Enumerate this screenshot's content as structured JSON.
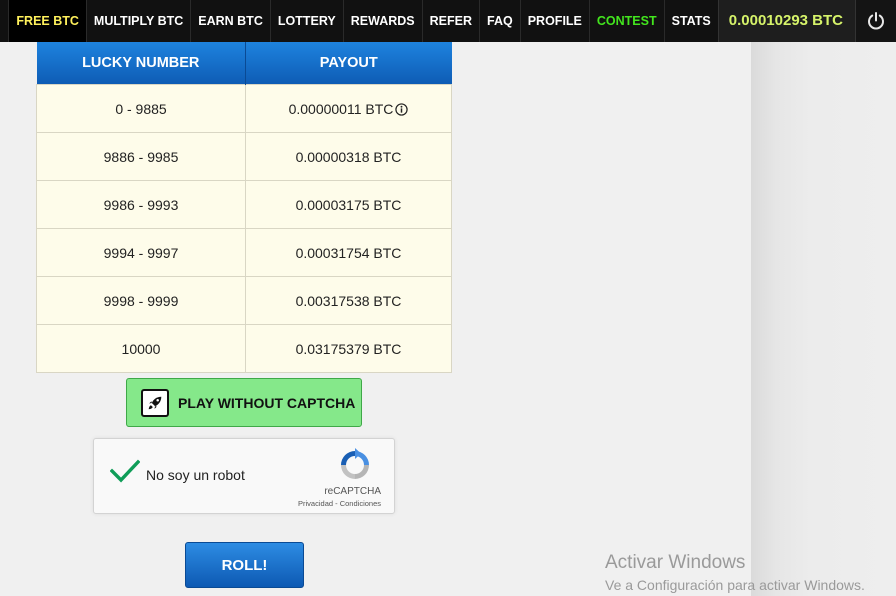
{
  "nav": {
    "items": [
      {
        "label": "FREE BTC",
        "style": "yellow"
      },
      {
        "label": "MULTIPLY BTC",
        "style": ""
      },
      {
        "label": "EARN BTC",
        "style": ""
      },
      {
        "label": "LOTTERY",
        "style": ""
      },
      {
        "label": "REWARDS",
        "style": ""
      },
      {
        "label": "REFER",
        "style": ""
      },
      {
        "label": "FAQ",
        "style": ""
      },
      {
        "label": "PROFILE",
        "style": ""
      },
      {
        "label": "CONTEST",
        "style": "green"
      },
      {
        "label": "STATS",
        "style": ""
      }
    ],
    "balance": "0.00010293 BTC",
    "power_icon": "power-icon"
  },
  "payout_table": {
    "headers": [
      "LUCKY NUMBER",
      "PAYOUT"
    ],
    "rows": [
      {
        "range": "0 - 9885",
        "payout": "0.00000011 BTC",
        "info": true
      },
      {
        "range": "9886 - 9985",
        "payout": "0.00000318 BTC",
        "info": false
      },
      {
        "range": "9986 - 9993",
        "payout": "0.00003175 BTC",
        "info": false
      },
      {
        "range": "9994 - 9997",
        "payout": "0.00031754 BTC",
        "info": false
      },
      {
        "range": "9998 - 9999",
        "payout": "0.00317538 BTC",
        "info": false
      },
      {
        "range": "10000",
        "payout": "0.03175379 BTC",
        "info": false
      }
    ]
  },
  "play_button": {
    "label": "PLAY WITHOUT CAPTCHA",
    "icon": "rocket-icon"
  },
  "recaptcha": {
    "label": "No soy un robot",
    "brand": "reCAPTCHA",
    "privacy": "Privacidad",
    "separator": " - ",
    "terms": "Condiciones"
  },
  "roll_button": {
    "label": "ROLL!"
  },
  "watermark": {
    "title": "Activar Windows",
    "subtitle": "Ve a Configuración para activar Windows."
  },
  "colors": {
    "nav_bg": "#111111",
    "free_btc": "#fff15c",
    "contest": "#43e51e",
    "balance": "#d6f36a",
    "header_blue": "#1565c0",
    "cell_bg": "#fefcea",
    "play_green": "#85e88a",
    "check_green": "#0f9d58"
  }
}
